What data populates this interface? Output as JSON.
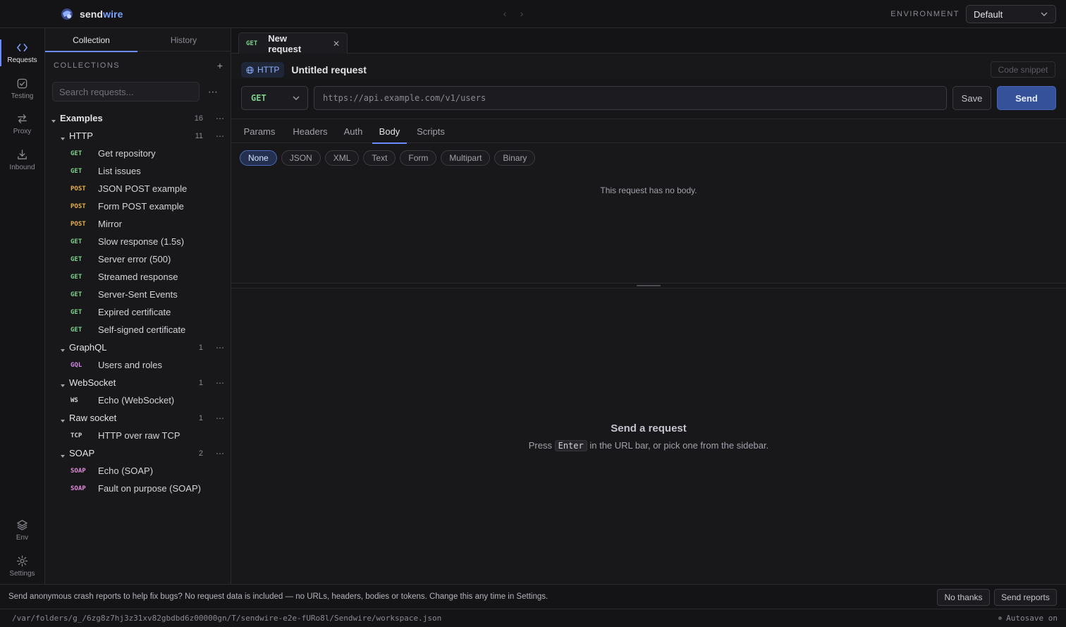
{
  "app": {
    "name_part1": "send",
    "name_part2": "wire",
    "environment_label": "ENVIRONMENT",
    "environment_value": "Default"
  },
  "rail": {
    "requests": "Requests",
    "testing": "Testing",
    "proxy": "Proxy",
    "inbound": "Inbound",
    "env": "Env",
    "settings": "Settings"
  },
  "sidebar": {
    "tabs": [
      "Collection",
      "History"
    ],
    "collections_label": "COLLECTIONS",
    "search_placeholder": "Search requests...",
    "root": {
      "name": "Examples",
      "count": "16"
    },
    "folders": [
      {
        "name": "HTTP",
        "count": "11",
        "items": [
          {
            "method": "GET",
            "name": "Get repository"
          },
          {
            "method": "GET",
            "name": "List issues"
          },
          {
            "method": "POST",
            "name": "JSON POST example"
          },
          {
            "method": "POST",
            "name": "Form POST example"
          },
          {
            "method": "POST",
            "name": "Mirror"
          },
          {
            "method": "GET",
            "name": "Slow response (1.5s)"
          },
          {
            "method": "GET",
            "name": "Server error (500)"
          },
          {
            "method": "GET",
            "name": "Streamed response"
          },
          {
            "method": "GET",
            "name": "Server-Sent Events"
          },
          {
            "method": "GET",
            "name": "Expired certificate"
          },
          {
            "method": "GET",
            "name": "Self-signed certificate"
          }
        ]
      },
      {
        "name": "GraphQL",
        "count": "1",
        "items": [
          {
            "method": "GQL",
            "name": "Users and roles"
          }
        ]
      },
      {
        "name": "WebSocket",
        "count": "1",
        "items": [
          {
            "method": "WS",
            "name": "Echo (WebSocket)"
          }
        ]
      },
      {
        "name": "Raw socket",
        "count": "1",
        "items": [
          {
            "method": "TCP",
            "name": "HTTP over raw TCP"
          }
        ]
      },
      {
        "name": "SOAP",
        "count": "2",
        "items": [
          {
            "method": "SOAP",
            "name": "Echo (SOAP)"
          },
          {
            "method": "SOAP",
            "name": "Fault on purpose (SOAP)"
          }
        ]
      }
    ]
  },
  "method_colors": {
    "GET": "#7ccf8a",
    "POST": "#e8b04a",
    "GQL": "#d08ae6",
    "WS": "#d4d4d8",
    "TCP": "#d4d4d8",
    "SOAP": "#e08ad8"
  },
  "request_tab": {
    "method": "GET",
    "title": "New request"
  },
  "request": {
    "protocol": "HTTP",
    "title": "Untitled request",
    "code_snippet": "Code snippet",
    "method": "GET",
    "url_placeholder": "https://api.example.com/v1/users",
    "save": "Save",
    "send": "Send"
  },
  "request_tabs": [
    "Params",
    "Headers",
    "Auth",
    "Body",
    "Scripts"
  ],
  "active_request_tab": "Body",
  "body_types": [
    "None",
    "JSON",
    "XML",
    "Text",
    "Form",
    "Multipart",
    "Binary"
  ],
  "active_body_type": "None",
  "no_body_text": "This request has no body.",
  "response_empty": {
    "title": "Send a request",
    "hint_before": "Press",
    "hint_key": "Enter",
    "hint_after": "in the URL bar, or pick one from the sidebar."
  },
  "crash_banner": {
    "text": "Send anonymous crash reports to help fix bugs? No request data is included — no URLs, headers, bodies or tokens. Change this any time in Settings.",
    "decline": "No thanks",
    "accept": "Send reports"
  },
  "statusbar": {
    "path": "/var/folders/g_/6zg8z7hj3z31xv82gbdbd6z00000gn/T/sendwire-e2e-fURo8l/Sendwire/workspace.json",
    "autosave": "Autosave on"
  }
}
